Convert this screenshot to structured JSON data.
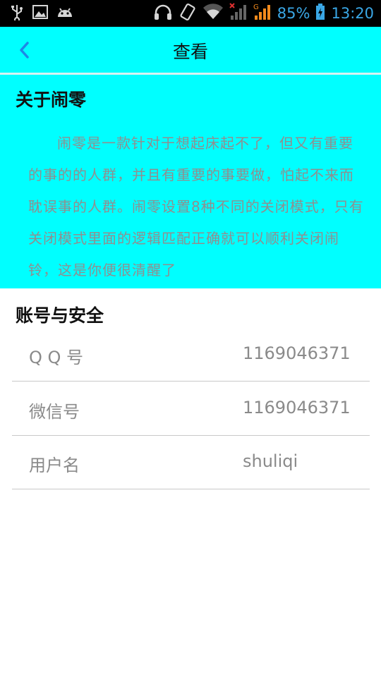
{
  "status_bar": {
    "battery_percent": "85%",
    "time": "13:20",
    "icons": [
      "usb-icon",
      "image-icon",
      "android-icon",
      "headphones-icon",
      "vibrate-icon",
      "wifi-icon",
      "signal-icon",
      "signal-g-icon",
      "battery-charging-icon"
    ],
    "network_label": "G",
    "accent_color": "#3aa7e6"
  },
  "header": {
    "title": "查看",
    "back_icon": "chevron-left-icon",
    "background": "#00ffff"
  },
  "about": {
    "heading": "关于闹零",
    "body": "闹零是一款针对于想起床起不了，但又有重要的事的的人群，并且有重要的事要做，怕起不来而耽误事的人群。闹零设置8种不同的关闭模式，只有关闭模式里面的逻辑匹配正确就可以顺利关闭闹铃，这是你便很清醒了"
  },
  "account": {
    "heading": "账号与安全",
    "rows": [
      {
        "label": "Q Q 号",
        "value": "1169046371"
      },
      {
        "label": "微信号",
        "value": "1169046371"
      },
      {
        "label": "用户名",
        "value": "shuliqi"
      }
    ]
  }
}
